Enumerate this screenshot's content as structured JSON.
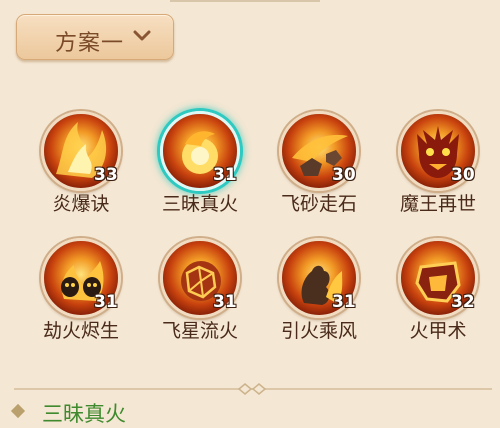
{
  "scheme": {
    "label": "方案一"
  },
  "skills": [
    {
      "name": "炎爆诀",
      "level": "33",
      "icon": "flame-swirl-icon"
    },
    {
      "name": "三昧真火",
      "level": "31",
      "icon": "fire-orb-icon",
      "selected": true
    },
    {
      "name": "飞砂走石",
      "level": "30",
      "icon": "flying-rocks-icon"
    },
    {
      "name": "魔王再世",
      "level": "30",
      "icon": "demon-king-icon"
    },
    {
      "name": "劫火烬生",
      "level": "31",
      "icon": "skull-fire-icon"
    },
    {
      "name": "飞星流火",
      "level": "31",
      "icon": "meteor-icon"
    },
    {
      "name": "引火乘风",
      "level": "31",
      "icon": "fire-spirit-icon"
    },
    {
      "name": "火甲术",
      "level": "32",
      "icon": "fire-armor-icon"
    }
  ],
  "selected_skill": {
    "name": "三昧真火"
  },
  "colors": {
    "selected_ring": "#2ec9c0",
    "selected_text": "#3f8a2e",
    "label_text": "#4a2a1a"
  }
}
